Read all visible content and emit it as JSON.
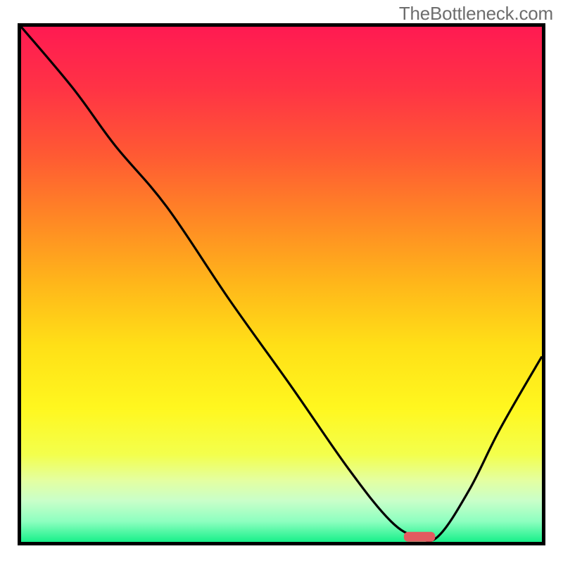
{
  "watermark": "TheBottleneck.com",
  "colors": {
    "border": "#000000",
    "watermark_text": "#6d6d6d",
    "marker_fill": "#e35b60",
    "curve_stroke": "#000000",
    "gradient_stops": [
      {
        "offset": 0.0,
        "color": "#ff1a52"
      },
      {
        "offset": 0.12,
        "color": "#ff3345"
      },
      {
        "offset": 0.25,
        "color": "#ff5a33"
      },
      {
        "offset": 0.38,
        "color": "#ff8a24"
      },
      {
        "offset": 0.5,
        "color": "#ffb71a"
      },
      {
        "offset": 0.62,
        "color": "#ffe017"
      },
      {
        "offset": 0.74,
        "color": "#fff71f"
      },
      {
        "offset": 0.83,
        "color": "#f3ff4c"
      },
      {
        "offset": 0.88,
        "color": "#e4ffa0"
      },
      {
        "offset": 0.92,
        "color": "#c9ffc9"
      },
      {
        "offset": 0.96,
        "color": "#8effc0"
      },
      {
        "offset": 1.0,
        "color": "#18f08a"
      }
    ]
  },
  "chart_data": {
    "type": "line",
    "title": "",
    "xlabel": "",
    "ylabel": "",
    "xlim": [
      0,
      100
    ],
    "ylim": [
      0,
      100
    ],
    "x": [
      0,
      10,
      18,
      28,
      40,
      52,
      63,
      71,
      76,
      80,
      86,
      92,
      100
    ],
    "values": [
      100,
      88,
      77,
      65,
      47,
      30,
      14,
      4,
      1,
      1,
      10,
      22,
      36
    ],
    "marker": {
      "x_range": [
        73.5,
        79.5
      ],
      "y": 1
    },
    "note": "Values read from the image: y=0 is the green bottom edge, y=100 is the red top edge; x runs left-to-right inside the framed plot area."
  }
}
